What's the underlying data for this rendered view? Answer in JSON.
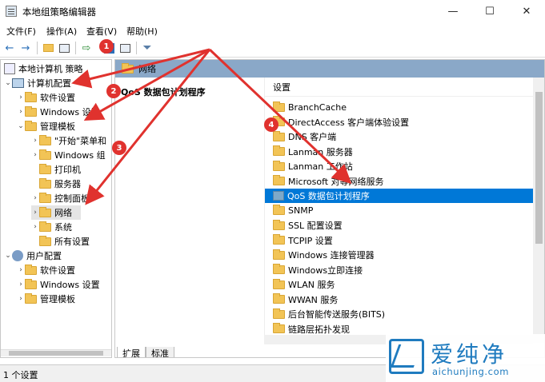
{
  "window": {
    "title": "本地组策略编辑器",
    "minimize": "—",
    "maximize": "☐",
    "close": "✕"
  },
  "menu": [
    {
      "label": "文件(F)"
    },
    {
      "label": "操作(A)"
    },
    {
      "label": "查看(V)"
    },
    {
      "label": "帮助(H)"
    }
  ],
  "toolbar": {
    "back": "←",
    "forward": "→",
    "filter": "filter-icon"
  },
  "tree": {
    "root": "本地计算机 策略",
    "computer": "计算机配置",
    "software": "软件设置",
    "windows": "Windows 设置",
    "admin": "管理模板",
    "start": "\"开始\"菜单和",
    "wincomp": "Windows 组",
    "printer": "打印机",
    "server": "服务器",
    "control": "控制面板",
    "network": "网络",
    "system": "系统",
    "all": "所有设置",
    "user": "用户配置",
    "u_software": "软件设置",
    "u_windows": "Windows 设置",
    "u_admin": "管理模板"
  },
  "right": {
    "header": "网络",
    "desc_title": "QoS 数据包计划程序",
    "col_header": "设置",
    "items": [
      "BranchCache",
      "DirectAccess 客户端体验设置",
      "DNS 客户端",
      "Lanman 服务器",
      "Lanman 工作站",
      "Microsoft 对等网络服务",
      "QoS 数据包计划程序",
      "SNMP",
      "SSL 配置设置",
      "TCPIP 设置",
      "Windows 连接管理器",
      "Windows立即连接",
      "WLAN 服务",
      "WWAN 服务",
      "后台智能传送服务(BITS)",
      "链路层拓扑发现"
    ]
  },
  "tabs": [
    {
      "label": "扩展"
    },
    {
      "label": "标准"
    }
  ],
  "status": "1 个设置",
  "badges": [
    "1",
    "2",
    "3",
    "4"
  ],
  "watermark": {
    "text": "爱纯净",
    "url": "aichunjing.com"
  }
}
